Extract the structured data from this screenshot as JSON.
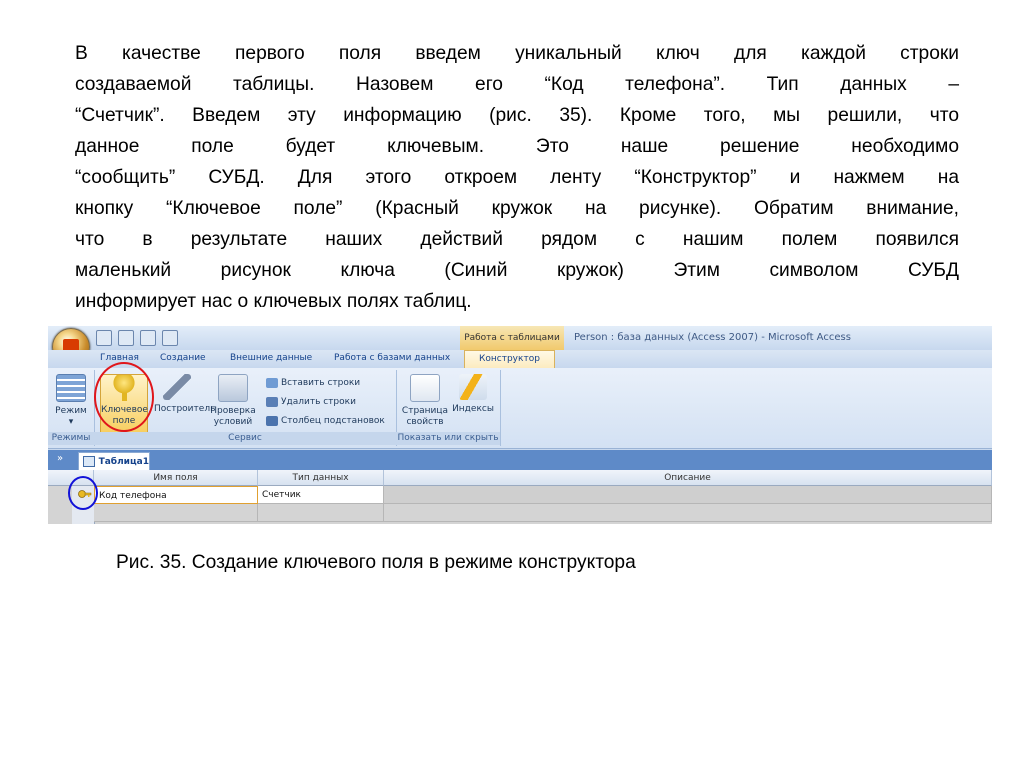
{
  "paragraph_lines": [
    "В качестве первого поля введем уникальный ключ для каждой строки",
    "создаваемой таблицы. Назовем его “Код телефона”. Тип данных –",
    "“Счетчик”. Введем эту информацию (рис. 35). Кроме того, мы решили, что",
    "данное поле будет ключевым. Это наше решение необходимо",
    "“сообщить” СУБД. Для этого откроем ленту “Конструктор” и нажмем на",
    "кнопку “Ключевое поле” (Красный кружок на рисунке). Обратим внимание,",
    "что в результате наших действий рядом с нашим полем появился",
    "маленький рисунок ключа (Синий кружок)  Этим символом СУБД",
    "информирует нас о ключевых полях таблиц."
  ],
  "caption": "Рис. 35. Создание ключевого поля в режиме конструктора",
  "access": {
    "context_tab": "Работа с таблицами",
    "window_title": "Person : база данных (Access 2007) - Microsoft Access",
    "tabs": [
      "Главная",
      "Создание",
      "Внешние данные",
      "Работа с базами данных",
      "Конструктор"
    ],
    "ribbon": {
      "mode_label": "Режим",
      "key_field_label_1": "Ключевое",
      "key_field_label_2": "поле",
      "builder_label": "Построитель",
      "check_label_1": "Проверка",
      "check_label_2": "условий",
      "insert_rows": "Вставить строки",
      "delete_rows": "Удалить строки",
      "lookup_column": "Столбец подстановок",
      "property_sheet_1": "Страница",
      "property_sheet_2": "свойств",
      "indexes": "Индексы",
      "group_modes": "Режимы",
      "group_service": "Сервис",
      "group_show_hide": "Показать или скрыть"
    },
    "nav_toggle": "»",
    "doc_tab": "Таблица1",
    "grid": {
      "headers": [
        "Имя поля",
        "Тип данных",
        "Описание"
      ],
      "rows": [
        {
          "field_name": "Код телефона",
          "data_type": "Счетчик",
          "description": ""
        }
      ]
    }
  },
  "colors": {
    "red_circle": "#e0161b",
    "blue_circle": "#1212d8"
  }
}
